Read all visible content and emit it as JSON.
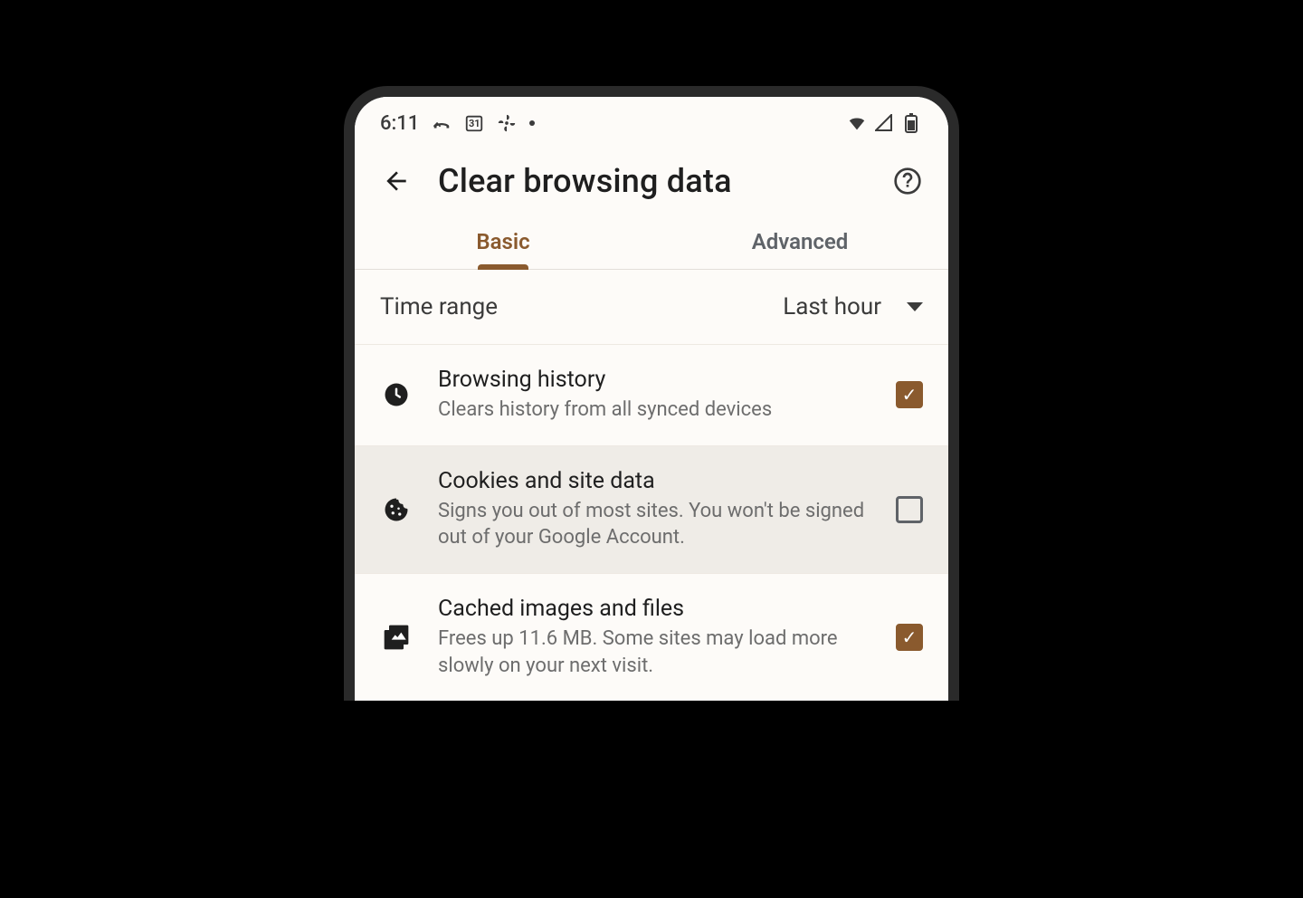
{
  "status_bar": {
    "time": "6:11",
    "calendar_day": "31"
  },
  "app_bar": {
    "title": "Clear browsing data"
  },
  "tabs": [
    {
      "label": "Basic",
      "active": true
    },
    {
      "label": "Advanced",
      "active": false
    }
  ],
  "time_range": {
    "label": "Time range",
    "value": "Last hour"
  },
  "items": [
    {
      "icon": "clock-icon",
      "title": "Browsing history",
      "subtitle": "Clears history from all synced devices",
      "checked": true,
      "highlight": false
    },
    {
      "icon": "cookie-icon",
      "title": "Cookies and site data",
      "subtitle": "Signs you out of most sites. You won't be signed out of your Google Account.",
      "checked": false,
      "highlight": true
    },
    {
      "icon": "image-icon",
      "title": "Cached images and files",
      "subtitle": "Frees up 11.6 MB. Some sites may load more slowly on your next visit.",
      "checked": true,
      "highlight": false
    }
  ],
  "colors": {
    "accent": "#8a5a2e"
  }
}
